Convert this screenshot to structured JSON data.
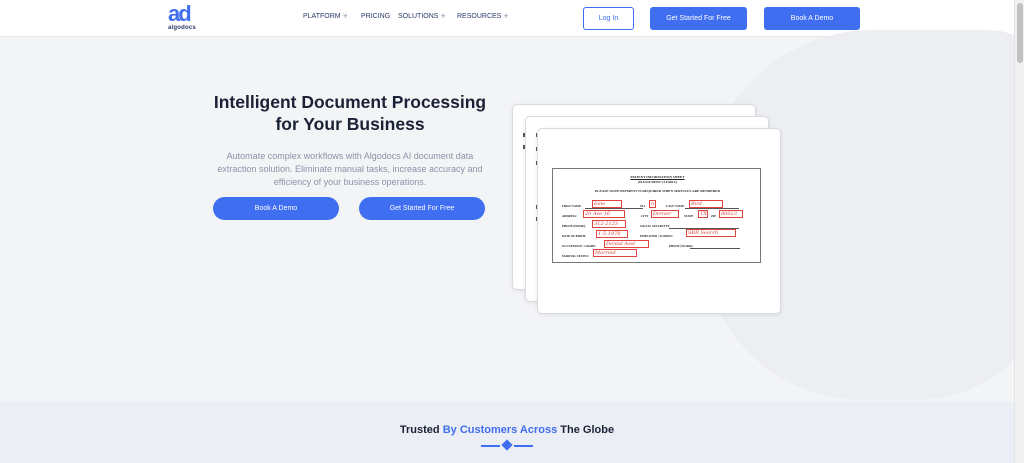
{
  "brand": {
    "logo_mark": "ad",
    "logo_text": "algodocs",
    "accent": "#3f6ef0"
  },
  "nav": {
    "items": [
      {
        "label": "PLATFORM",
        "has_plus": true
      },
      {
        "label": "PRICING",
        "has_plus": false
      },
      {
        "label": "SOLUTIONS",
        "has_plus": true
      },
      {
        "label": "RESOURCES",
        "has_plus": true
      }
    ],
    "plus_glyph": "+"
  },
  "header_buttons": {
    "login": "Log In",
    "get_started": "Get Started For Free",
    "book_demo": "Book A Demo"
  },
  "hero": {
    "title_line1": "Intelligent Document Processing",
    "title_line2": "for Your Business",
    "subtitle_line1": "Automate complex workflows with Algodocs AI document data",
    "subtitle_line2": "extraction solution. Eliminate manual tasks, increase accuracy and",
    "subtitle_line3": "efficiency of your business operations.",
    "book_demo": "Book A Demo",
    "get_started": "Get Started For Free"
  },
  "document": {
    "title": "PATIENT INFORMATION SHEET",
    "subtitle": "(PLEASE PRINT CLEARLY)",
    "note": "PLEASE NOTE PAYMENT IS REQUIRED WHEN SERVICES ARE RENDERED",
    "labels": {
      "first_name": "FIRST NAME:",
      "mi": "M.I.",
      "last_name": "LAST NAME:",
      "address": "ADDRESS:",
      "city": "CITY",
      "state": "STATE",
      "zip": "ZIP",
      "phone": "PHONE (HOME):",
      "ssn": "SOCIAL SECURITY#:",
      "dob": "DATE OF BIRTH:",
      "employer": "EMPLOYER / SCHOOL:",
      "occupation": "OCCUPATION / GRADE:",
      "phone_work": "PHONE (WORK):",
      "marital": "MARITAL STATUS:"
    },
    "values": {
      "first_name": "Ione",
      "mi": "n",
      "last_name": "Bird",
      "address": "20 Ave 16",
      "city": "Denver",
      "state": "TX",
      "zip": "80023",
      "phone": "312-2123",
      "dob": "1-5-1978",
      "employer": "SBR Search",
      "occupation": "Dental Asst",
      "marital": "Married"
    }
  },
  "trusted": {
    "prefix": "Trusted ",
    "highlight": "By Customers Across",
    "suffix": " The Globe"
  }
}
